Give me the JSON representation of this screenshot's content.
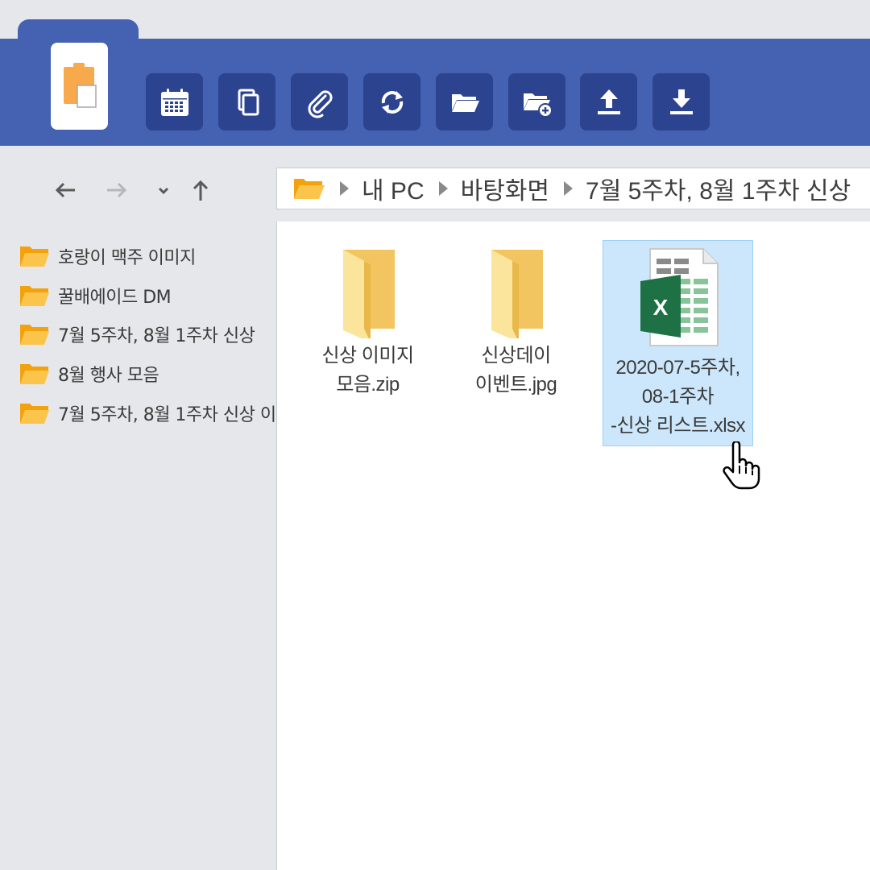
{
  "toolbar": {
    "buttons": [
      {
        "icon": "calendar-icon"
      },
      {
        "icon": "copy-icon"
      },
      {
        "icon": "paperclip-icon"
      },
      {
        "icon": "sync-icon"
      },
      {
        "icon": "folder-icon"
      },
      {
        "icon": "new-folder-icon"
      },
      {
        "icon": "upload-icon"
      },
      {
        "icon": "download-icon"
      }
    ]
  },
  "nav": {
    "back": "back-arrow-icon",
    "forward": "forward-arrow-icon",
    "recent": "chevron-down-icon",
    "up": "up-arrow-icon"
  },
  "breadcrumb": [
    "내 PC",
    "바탕화면",
    "7월 5주차, 8월 1주차 신상"
  ],
  "sidebar": {
    "items": [
      {
        "label": "호랑이 맥주 이미지"
      },
      {
        "label": "꿀배에이드 DM"
      },
      {
        "label": "7월 5주차, 8월 1주차 신상"
      },
      {
        "label": "8월 행사 모음"
      },
      {
        "label": "7월 5주차, 8월 1주차 신상 이..."
      }
    ]
  },
  "files": [
    {
      "name_line1": "신상 이미지",
      "name_line2": "모음.zip",
      "icon": "folder-icon"
    },
    {
      "name_line1": "신상데이",
      "name_line2": "이벤트.jpg",
      "icon": "folder-icon"
    },
    {
      "name_line1": "2020-07-5주차,",
      "name_line2": "08-1주차",
      "name_line3": "-신상 리스트.xlsx",
      "icon": "excel-file-icon",
      "selected": true
    }
  ],
  "colors": {
    "header": "#4462b1",
    "tool_button": "#2c438f",
    "folder": "#f9b935",
    "selection": "#cce7fb",
    "excel_green": "#1e7145"
  }
}
